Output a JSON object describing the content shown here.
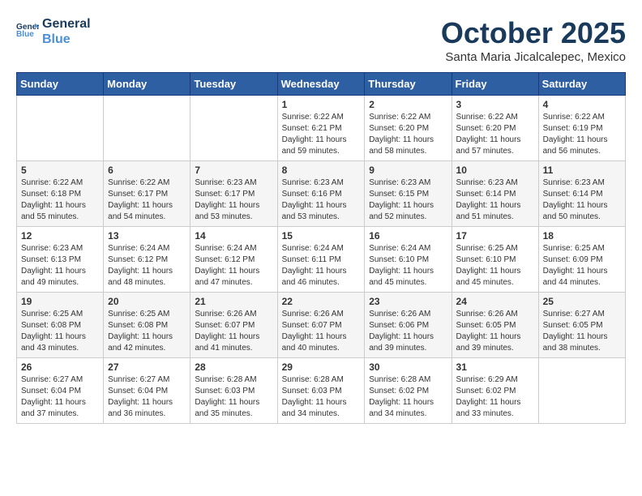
{
  "header": {
    "logo_line1": "General",
    "logo_line2": "Blue",
    "month": "October 2025",
    "location": "Santa Maria Jicalcalepec, Mexico"
  },
  "days_of_week": [
    "Sunday",
    "Monday",
    "Tuesday",
    "Wednesday",
    "Thursday",
    "Friday",
    "Saturday"
  ],
  "weeks": [
    [
      {
        "day": "",
        "content": ""
      },
      {
        "day": "",
        "content": ""
      },
      {
        "day": "",
        "content": ""
      },
      {
        "day": "1",
        "content": "Sunrise: 6:22 AM\nSunset: 6:21 PM\nDaylight: 11 hours\nand 59 minutes."
      },
      {
        "day": "2",
        "content": "Sunrise: 6:22 AM\nSunset: 6:20 PM\nDaylight: 11 hours\nand 58 minutes."
      },
      {
        "day": "3",
        "content": "Sunrise: 6:22 AM\nSunset: 6:20 PM\nDaylight: 11 hours\nand 57 minutes."
      },
      {
        "day": "4",
        "content": "Sunrise: 6:22 AM\nSunset: 6:19 PM\nDaylight: 11 hours\nand 56 minutes."
      }
    ],
    [
      {
        "day": "5",
        "content": "Sunrise: 6:22 AM\nSunset: 6:18 PM\nDaylight: 11 hours\nand 55 minutes."
      },
      {
        "day": "6",
        "content": "Sunrise: 6:22 AM\nSunset: 6:17 PM\nDaylight: 11 hours\nand 54 minutes."
      },
      {
        "day": "7",
        "content": "Sunrise: 6:23 AM\nSunset: 6:17 PM\nDaylight: 11 hours\nand 53 minutes."
      },
      {
        "day": "8",
        "content": "Sunrise: 6:23 AM\nSunset: 6:16 PM\nDaylight: 11 hours\nand 53 minutes."
      },
      {
        "day": "9",
        "content": "Sunrise: 6:23 AM\nSunset: 6:15 PM\nDaylight: 11 hours\nand 52 minutes."
      },
      {
        "day": "10",
        "content": "Sunrise: 6:23 AM\nSunset: 6:14 PM\nDaylight: 11 hours\nand 51 minutes."
      },
      {
        "day": "11",
        "content": "Sunrise: 6:23 AM\nSunset: 6:14 PM\nDaylight: 11 hours\nand 50 minutes."
      }
    ],
    [
      {
        "day": "12",
        "content": "Sunrise: 6:23 AM\nSunset: 6:13 PM\nDaylight: 11 hours\nand 49 minutes."
      },
      {
        "day": "13",
        "content": "Sunrise: 6:24 AM\nSunset: 6:12 PM\nDaylight: 11 hours\nand 48 minutes."
      },
      {
        "day": "14",
        "content": "Sunrise: 6:24 AM\nSunset: 6:12 PM\nDaylight: 11 hours\nand 47 minutes."
      },
      {
        "day": "15",
        "content": "Sunrise: 6:24 AM\nSunset: 6:11 PM\nDaylight: 11 hours\nand 46 minutes."
      },
      {
        "day": "16",
        "content": "Sunrise: 6:24 AM\nSunset: 6:10 PM\nDaylight: 11 hours\nand 45 minutes."
      },
      {
        "day": "17",
        "content": "Sunrise: 6:25 AM\nSunset: 6:10 PM\nDaylight: 11 hours\nand 45 minutes."
      },
      {
        "day": "18",
        "content": "Sunrise: 6:25 AM\nSunset: 6:09 PM\nDaylight: 11 hours\nand 44 minutes."
      }
    ],
    [
      {
        "day": "19",
        "content": "Sunrise: 6:25 AM\nSunset: 6:08 PM\nDaylight: 11 hours\nand 43 minutes."
      },
      {
        "day": "20",
        "content": "Sunrise: 6:25 AM\nSunset: 6:08 PM\nDaylight: 11 hours\nand 42 minutes."
      },
      {
        "day": "21",
        "content": "Sunrise: 6:26 AM\nSunset: 6:07 PM\nDaylight: 11 hours\nand 41 minutes."
      },
      {
        "day": "22",
        "content": "Sunrise: 6:26 AM\nSunset: 6:07 PM\nDaylight: 11 hours\nand 40 minutes."
      },
      {
        "day": "23",
        "content": "Sunrise: 6:26 AM\nSunset: 6:06 PM\nDaylight: 11 hours\nand 39 minutes."
      },
      {
        "day": "24",
        "content": "Sunrise: 6:26 AM\nSunset: 6:05 PM\nDaylight: 11 hours\nand 39 minutes."
      },
      {
        "day": "25",
        "content": "Sunrise: 6:27 AM\nSunset: 6:05 PM\nDaylight: 11 hours\nand 38 minutes."
      }
    ],
    [
      {
        "day": "26",
        "content": "Sunrise: 6:27 AM\nSunset: 6:04 PM\nDaylight: 11 hours\nand 37 minutes."
      },
      {
        "day": "27",
        "content": "Sunrise: 6:27 AM\nSunset: 6:04 PM\nDaylight: 11 hours\nand 36 minutes."
      },
      {
        "day": "28",
        "content": "Sunrise: 6:28 AM\nSunset: 6:03 PM\nDaylight: 11 hours\nand 35 minutes."
      },
      {
        "day": "29",
        "content": "Sunrise: 6:28 AM\nSunset: 6:03 PM\nDaylight: 11 hours\nand 34 minutes."
      },
      {
        "day": "30",
        "content": "Sunrise: 6:28 AM\nSunset: 6:02 PM\nDaylight: 11 hours\nand 34 minutes."
      },
      {
        "day": "31",
        "content": "Sunrise: 6:29 AM\nSunset: 6:02 PM\nDaylight: 11 hours\nand 33 minutes."
      },
      {
        "day": "",
        "content": ""
      }
    ]
  ]
}
